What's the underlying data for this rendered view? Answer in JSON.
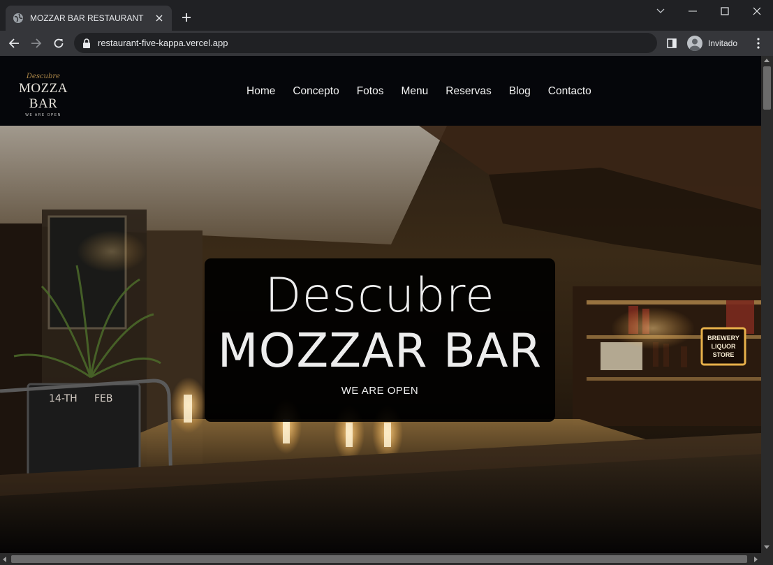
{
  "browser": {
    "tab_title": "MOZZAR BAR RESTAURANT",
    "url": "restaurant-five-kappa.vercel.app",
    "profile_label": "Invitado"
  },
  "site": {
    "logo": {
      "script": "Descubre",
      "main": "MOZZA BAR",
      "sub": "WE ARE OPEN"
    },
    "nav": [
      "Home",
      "Concepto",
      "Fotos",
      "Menu",
      "Reservas",
      "Blog",
      "Contacto"
    ]
  },
  "hero": {
    "line1": "Descubre",
    "line2": "MOZZAR BAR",
    "tagline": "WE ARE OPEN",
    "sign_text": [
      "BREWERY",
      "LIQUOR",
      "STORE"
    ],
    "chalkboard_text": [
      "14-TH",
      "FEB"
    ]
  },
  "colors": {
    "chrome_bg": "#202124",
    "toolbar_bg": "#35363a",
    "header_bg": "#05060a",
    "accent_gold": "#b08a4a"
  }
}
